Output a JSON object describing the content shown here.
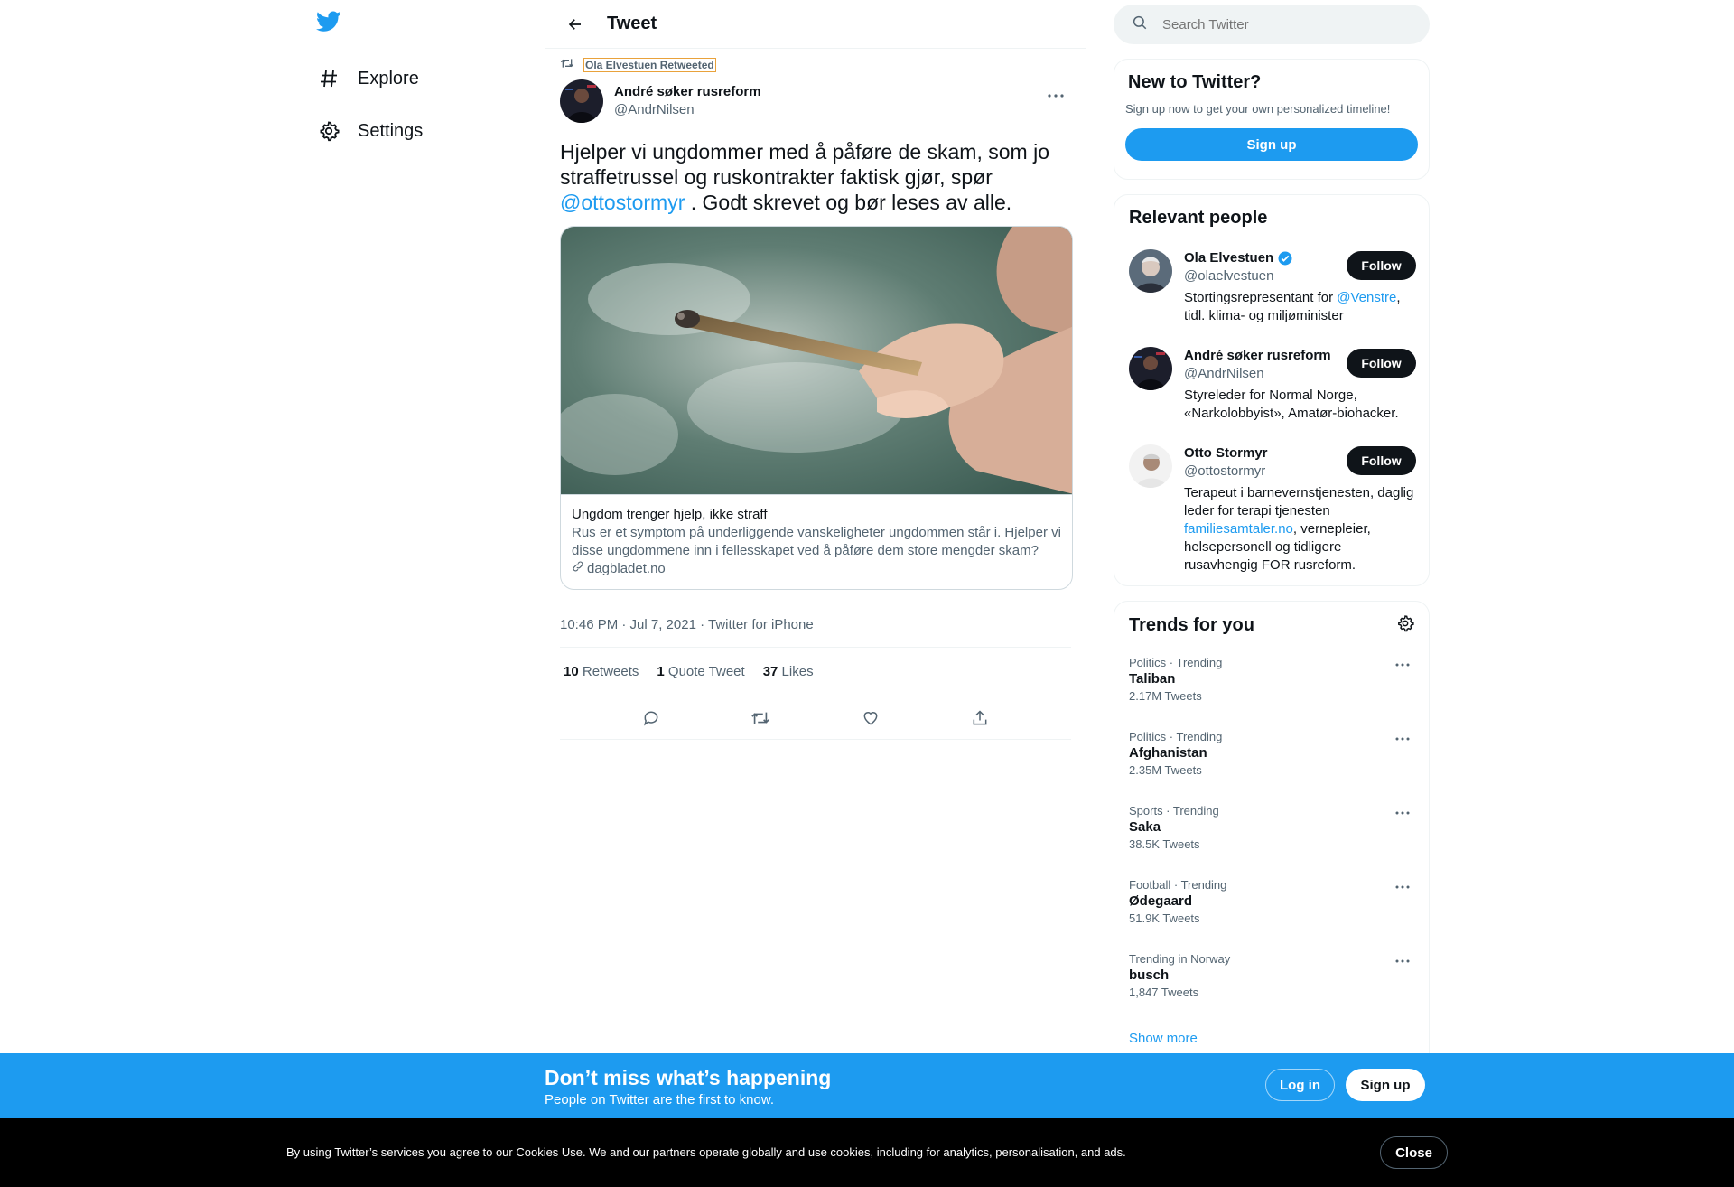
{
  "nav": {
    "logo": "twitter-bird-icon",
    "items": [
      {
        "label": "Explore",
        "icon": "hashtag-icon"
      },
      {
        "label": "Settings",
        "icon": "gear-icon"
      }
    ]
  },
  "header": {
    "title": "Tweet",
    "back_icon": "arrow-left-icon"
  },
  "tweet": {
    "retweeted_by": "Ola Elvestuen Retweeted",
    "author_name": "André søker rusreform",
    "author_handle": "@AndrNilsen",
    "text_part1": "Hjelper vi ungdommer med å påføre de skam, som jo straffetrussel og ruskontrakter faktisk gjør, spør ",
    "mention": "@ottostormyr",
    "text_part2": " . Godt skrevet og bør leses av alle.",
    "card": {
      "title": "Ungdom trenger hjelp, ikke straff",
      "description": "Rus er et symptom på underliggende vanskeligheter ungdommen står i. Hjelper vi disse ungdommene inn i fellesskapet ved å påføre dem store mengder skam?",
      "domain": "dagbladet.no"
    },
    "meta": "10:46 PM · Jul 7, 2021 · Twitter for iPhone",
    "stats": {
      "retweets_count": "10",
      "retweets_label": "Retweets",
      "quotes_count": "1",
      "quotes_label": "Quote Tweet",
      "likes_count": "37",
      "likes_label": "Likes"
    }
  },
  "search": {
    "placeholder": "Search Twitter"
  },
  "new_to_twitter": {
    "title": "New to Twitter?",
    "subtitle": "Sign up now to get your own personalized timeline!",
    "button": "Sign up"
  },
  "relevant_people": {
    "title": "Relevant people",
    "people": [
      {
        "name": "Ola Elvestuen",
        "handle": "@olaelvestuen",
        "verified": true,
        "bio_part1": "Stortingsrepresentant for ",
        "bio_link": "@Venstre",
        "bio_part2": ", tidl. klima- og miljøminister",
        "follow": "Follow"
      },
      {
        "name": "André søker rusreform",
        "handle": "@AndrNilsen",
        "verified": false,
        "bio_part1": "Styreleder for Normal Norge, «Narkolobbyist», Amatør-biohacker.",
        "bio_link": "",
        "bio_part2": "",
        "follow": "Follow"
      },
      {
        "name": "Otto Stormyr",
        "handle": "@ottostormyr",
        "verified": false,
        "bio_part1": "Terapeut i barnevernstjenesten, daglig leder for terapi tjenesten ",
        "bio_link": "familiesamtaler.no",
        "bio_part2": ", vernepleier, helsepersonell og tidligere rusavhengig FOR rusreform.",
        "follow": "Follow"
      }
    ]
  },
  "trends": {
    "title": "Trends for you",
    "items": [
      {
        "category": "Politics · Trending",
        "name": "Taliban",
        "count": "2.17M Tweets"
      },
      {
        "category": "Politics · Trending",
        "name": "Afghanistan",
        "count": "2.35M Tweets"
      },
      {
        "category": "Sports · Trending",
        "name": "Saka",
        "count": "38.5K Tweets"
      },
      {
        "category": "Football · Trending",
        "name": "Ødegaard",
        "count": "51.9K Tweets"
      },
      {
        "category": "Trending in Norway",
        "name": "busch",
        "count": "1,847 Tweets"
      }
    ],
    "show_more": "Show more"
  },
  "bottom_bar": {
    "title": "Don’t miss what’s happening",
    "subtitle": "People on Twitter are the first to know.",
    "login": "Log in",
    "signup": "Sign up"
  },
  "cookie_bar": {
    "text": "By using Twitter’s services you agree to our Cookies Use. We and our partners operate globally and use cookies, including for analytics, personalisation, and ads.",
    "close": "Close"
  },
  "colors": {
    "accent": "#1d9bf0",
    "text": "#0f1419",
    "secondary": "#536471"
  }
}
